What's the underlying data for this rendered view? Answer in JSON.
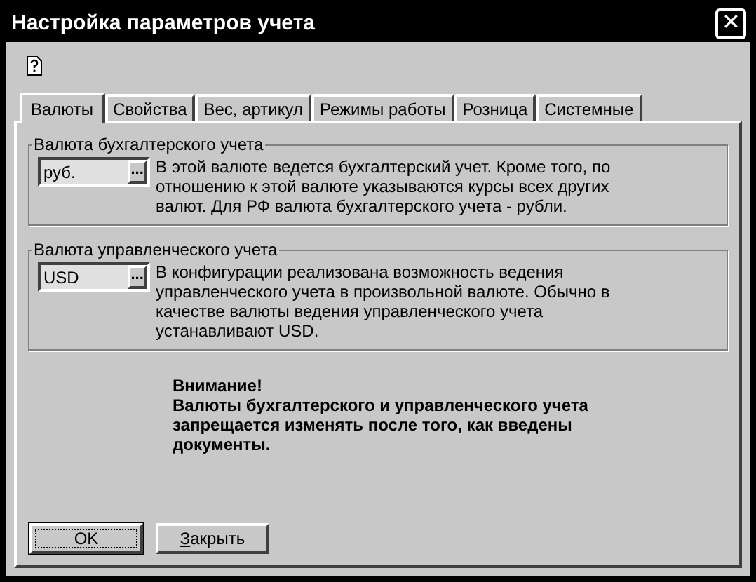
{
  "window": {
    "title": "Настройка параметров учета",
    "close": "✕"
  },
  "tabs": [
    {
      "label": "Валюты",
      "selected": true
    },
    {
      "label": "Свойства",
      "selected": false
    },
    {
      "label": "Вес, артикул",
      "selected": false
    },
    {
      "label": "Режимы работы",
      "selected": false
    },
    {
      "label": "Розница",
      "selected": false
    },
    {
      "label": "Системные",
      "selected": false
    }
  ],
  "groups": [
    {
      "title": "Валюта бухгалтерского учета",
      "value": "руб.",
      "browse": "...",
      "description": "В этой валюте ведется бухгалтерский учет. Кроме того, по отношению к этой валюте указываются курсы всех других валют. Для РФ валюта бухгалтерского учета - рубли."
    },
    {
      "title": "Валюта управленческого учета",
      "value": "USD",
      "browse": "...",
      "description": "В конфигурации реализована возможность ведения управленческого учета в произвольной валюте. Обычно в качестве валюты ведения управленческого учета устанавливают USD."
    }
  ],
  "warning": {
    "title": "Внимание!",
    "text": "Валюты бухгалтерского и управленческого учета запрещается изменять после того, как введены документы."
  },
  "buttons": [
    {
      "label": "OK",
      "default": true
    },
    {
      "label": "Закрыть",
      "default": false
    }
  ]
}
